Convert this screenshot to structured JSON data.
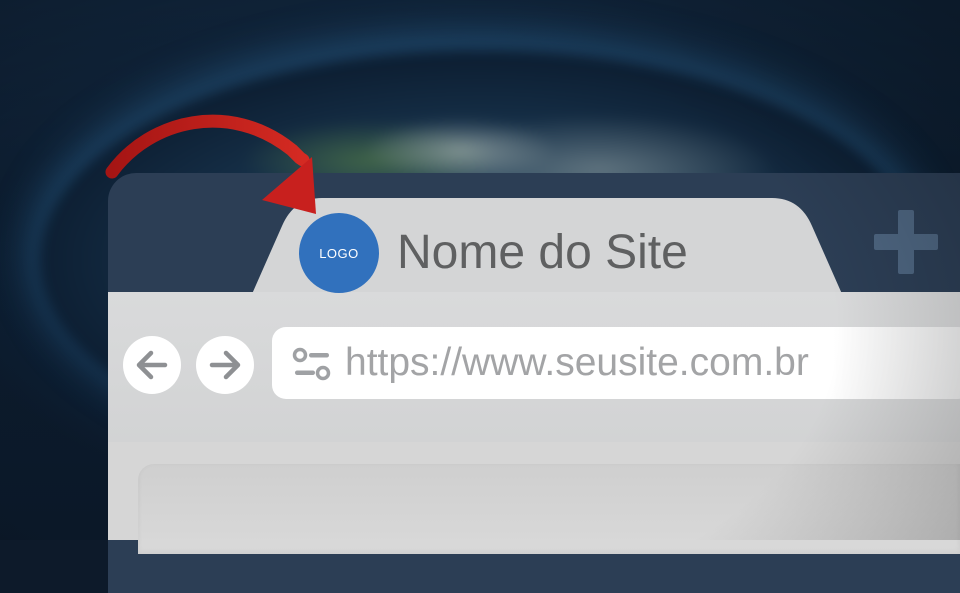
{
  "browser": {
    "tab": {
      "logo_text": "LOGO",
      "title": "Nome do Site"
    },
    "new_tab_icon": "plus-icon",
    "navigation": {
      "back_icon": "arrow-left-icon",
      "forward_icon": "arrow-right-icon"
    },
    "address_bar": {
      "url": "https://www.seusite.com.br",
      "settings_icon": "site-settings-icon"
    }
  },
  "colors": {
    "logo": "#3171bd",
    "arrow": "#c8201e",
    "window_frame": "#2c3e55",
    "tab": "#d2d3d4"
  }
}
